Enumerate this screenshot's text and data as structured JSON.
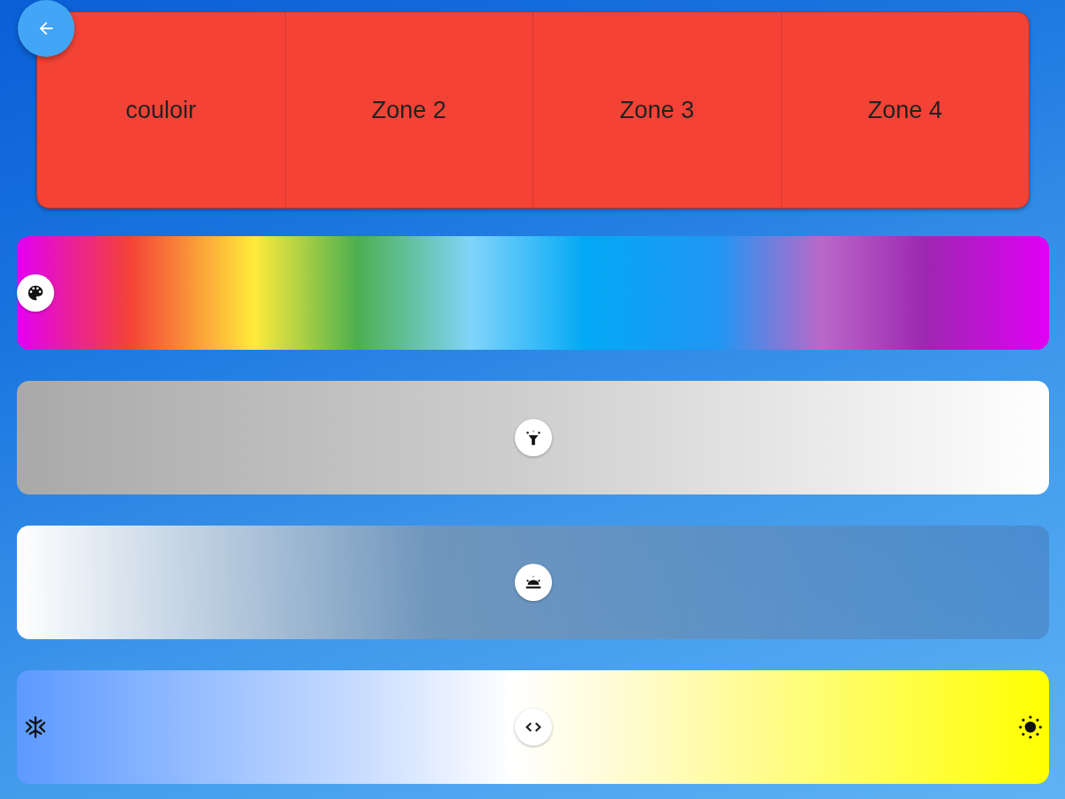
{
  "zones": [
    {
      "label": "couloir"
    },
    {
      "label": "Zone 2"
    },
    {
      "label": "Zone 3"
    },
    {
      "label": "Zone 4"
    }
  ],
  "sliders": [
    {
      "kind": "hue",
      "level": 0
    },
    {
      "kind": "brightness",
      "level": 0.5
    },
    {
      "kind": "saturation",
      "level": 0.5
    },
    {
      "kind": "temperature",
      "level": 0.5
    }
  ]
}
